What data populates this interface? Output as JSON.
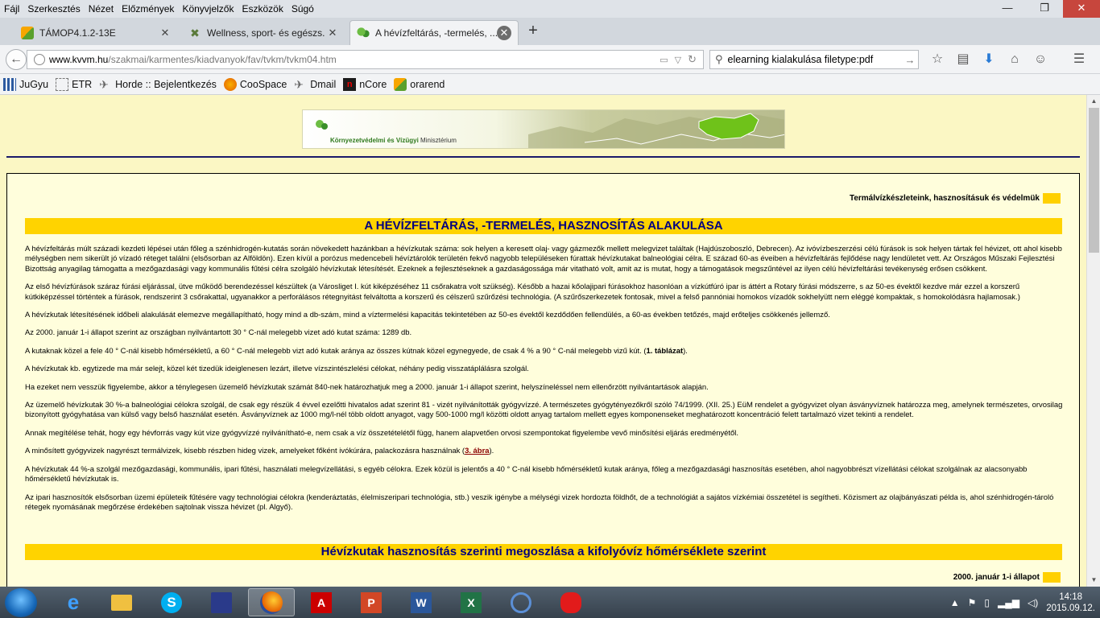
{
  "menubar": {
    "items": [
      "Fájl",
      "Szerkesztés",
      "Nézet",
      "Előzmények",
      "Könyvjelzők",
      "Eszközök",
      "Súgó"
    ]
  },
  "window_controls": {
    "minimize": "—",
    "maximize": "❐",
    "close": "✕"
  },
  "tabs": [
    {
      "label": "TÁMOP4.1.2-13E",
      "icon": "pma-logo-icon"
    },
    {
      "label": "Wellness, sport- és egészs...",
      "icon": "tools-icon"
    },
    {
      "label": "A hévízfeltárás, -termelés, ...",
      "icon": "ministry-leaf-icon",
      "active": true
    }
  ],
  "url": {
    "domain": "www.kvvm.hu",
    "path": "/szakmai/karmentes/kiadvanyok/fav/tvkm/tvkm04.htm"
  },
  "search": {
    "value": "elearning kialakulása filetype:pdf"
  },
  "bookmarks": [
    {
      "label": "JuGyu"
    },
    {
      "label": "ETR"
    },
    {
      "label": "Horde :: Bejelentkezés"
    },
    {
      "label": "CooSpace"
    },
    {
      "label": "Dmail"
    },
    {
      "label": "nCore"
    },
    {
      "label": "orarend"
    }
  ],
  "banner": {
    "ministry_bold": "Környezetvédelmi és Vízügyi",
    "ministry_rest": " Minisztérium"
  },
  "crumb": "Termálvízkészleteink, hasznosításuk és védelmük",
  "heading1": "A hévízfeltárás, -termelés, hasznosítás alakulása",
  "paragraphs": [
    "A hévízfeltárás múlt századi kezdeti lépései után főleg a szénhidrogén-kutatás során növekedett hazánkban a hévízkutak száma: sok helyen a keresett olaj- vagy gázmezők mellett melegvizet találtak (Hajdúszoboszló, Debrecen). Az ivóvízbeszerzési célú fúrások is sok helyen tártak fel hévizet, ott ahol kisebb mélységben nem sikerült jó vízadó réteget találni (elsősorban az Alföldön). Ezen kívül a porózus medencebeli hévíztárolók területén fekvő nagyobb településeken fúrattak hévízkutakat balneológiai célra. E század 60-as éveiben a hévízfeltárás fejlődése nagy lendületet vett. Az Országos Műszaki Fejlesztési Bizottság anyagilag támogatta a mezőgazdasági vagy kommunális fűtési célra szolgáló hévízkutak létesítését. Ezeknek a fejlesztéseknek a gazdaságossága már vitatható volt, amit az is mutat, hogy a támogatások megszűntével az ilyen célú hévízfeltárási tevékenység erősen csökkent.",
    "Az első hévízfúrások száraz fúrási eljárással, ütve működő berendezéssel készültek (a Városliget I. kút kiképzéséhez 11 csőrakatra volt szükség). Később a hazai kőolajipari fúrásokhoz hasonlóan a vízkútfúró ipar is áttért a Rotary fúrási módszerre, s az 50-es évektől kezdve már ezzel a korszerű kútkiképzéssel történtek a fúrások, rendszerint 3 csőrakattal, ugyanakkor a perforálásos rétegnyitást felváltotta a korszerű és célszerű szűrőzési technológia. (A szűrőszerkezetek fontosak, mivel a felső pannóniai homokos vízadók sokhelyütt nem eléggé kompaktak, s homokolódásra hajlamosak.)",
    "A hévízkutak létesítésének időbeli alakulását elemezve megállapítható, hogy mind a db-szám, mind a víztermelési kapacitás tekintetében az 50-es évektől kezdődően fellendülés, a 60-as években tetőzés, majd erőteljes csökkenés jellemző.",
    "Az 2000. január 1-i állapot szerint az országban nyilvántartott 30 ° C-nál melegebb vizet adó kutat száma: 1289 db.",
    "A kutaknak közel a fele 40 ° C-nál kisebb hőmérsékletű, a 60 ° C-nál melegebb vizt adó kutak aránya az összes kútnak közel egynegyede, de csak 4 % a 90 ° C-nál melegebb vizű kút. (",
    "A hévízkutak kb. egytizede ma már selejt, közel két tizedük ideiglenesen lezárt, illetve vízszintészlelési célokat, néhány pedig visszatáplálásra szolgál.",
    "Ha ezeket nem vesszük figyelembe, akkor a ténylegesen üzemelő hévízkutak számát 840-nek határozhatjuk meg a 2000. január 1-i állapot szerint, helyszíneléssel nem ellenőrzött nyilvántartások alapján.",
    "Az üzemelő hévízkutak 30 %-a balneológiai célokra szolgál, de csak egy részük  4 évvel ezelőtti hivatalos adat szerint 81 - vizét nyilvánították gyógyvízzé. A természetes gyógytényezőkről szóló 74/1999. (XII. 25.) EüM rendelet a gyógyvizet olyan ásványvíznek határozza meg, amelynek természetes, orvosilag bizonyított gyógyhatása van külső vagy belső használat esetén. Ásványvíznek az 1000 mg/l-nél több oldott anyagot, vagy 500-1000 mg/l közötti oldott anyag tartalom mellett egyes komponenseket meghatározott koncentráció felett tartalmazó vizet tekinti a rendelet.",
    "Annak megítélése tehát, hogy egy hévforrás vagy kút vize gyógyvízzé nyilvánítható-e, nem csak a víz összetételétől függ, hanem alapvetően orvosi szempontokat figyelembe vevő minősítési eljárás eredményétől.",
    "A minősített gyógyvizek nagyrészt termálvizek, kisebb részben hideg vizek, amelyeket főként ivókúrára, palackozásra használnak (",
    "A hévízkutak 44 %-a szolgál mezőgazdasági, kommunális, ipari fűtési, használati melegvízellátási, s egyéb célokra. Ezek közül is jelentős a 40 ° C-nál kisebb hőmérsékletű kutak aránya, főleg a mezőgazdasági hasznosítás esetében, ahol nagyobbrészt vízellátási célokat szolgálnak az alacsonyabb hőmérsékletű hévízkutak is.",
    "Az ipari hasznosítók elsősorban üzemi épületeik fűtésére vagy technológiai célokra (kenderáztatás, élelmiszeripari technológia, stb.) veszik igénybe a mélységi vizek hordozta földhőt, de a technológiát a sajátos vízkémiai összetétel is segítheti. Közismert az olajbányászati példa is, ahol szénhidrogén-tároló rétegek nyomásának megőrzése érdekében sajtolnak vissza hévizet (pl. Algyő)."
  ],
  "links": {
    "table1": "1. táblázat",
    "fig3": "3. ábra",
    "close_paren": ").",
    "close_paren_p5": ")."
  },
  "heading2": "Hévízkutak hasznosítás szerinti megoszlása a kifolyóvíz hőmérséklete szerint",
  "state_label": "2000. január 1-i állapot",
  "taskbar": {
    "apps": [
      "internet-explorer",
      "file-explorer",
      "skype",
      "save-disk",
      "firefox",
      "acrobat",
      "powerpoint",
      "word",
      "excel",
      "sync",
      "paint"
    ],
    "time": "14:18",
    "date": "2015.09.12."
  },
  "colors": {
    "page_bg": "#fbf7c4",
    "heading_bar": "#ffd300",
    "heading_text": "#000080"
  }
}
